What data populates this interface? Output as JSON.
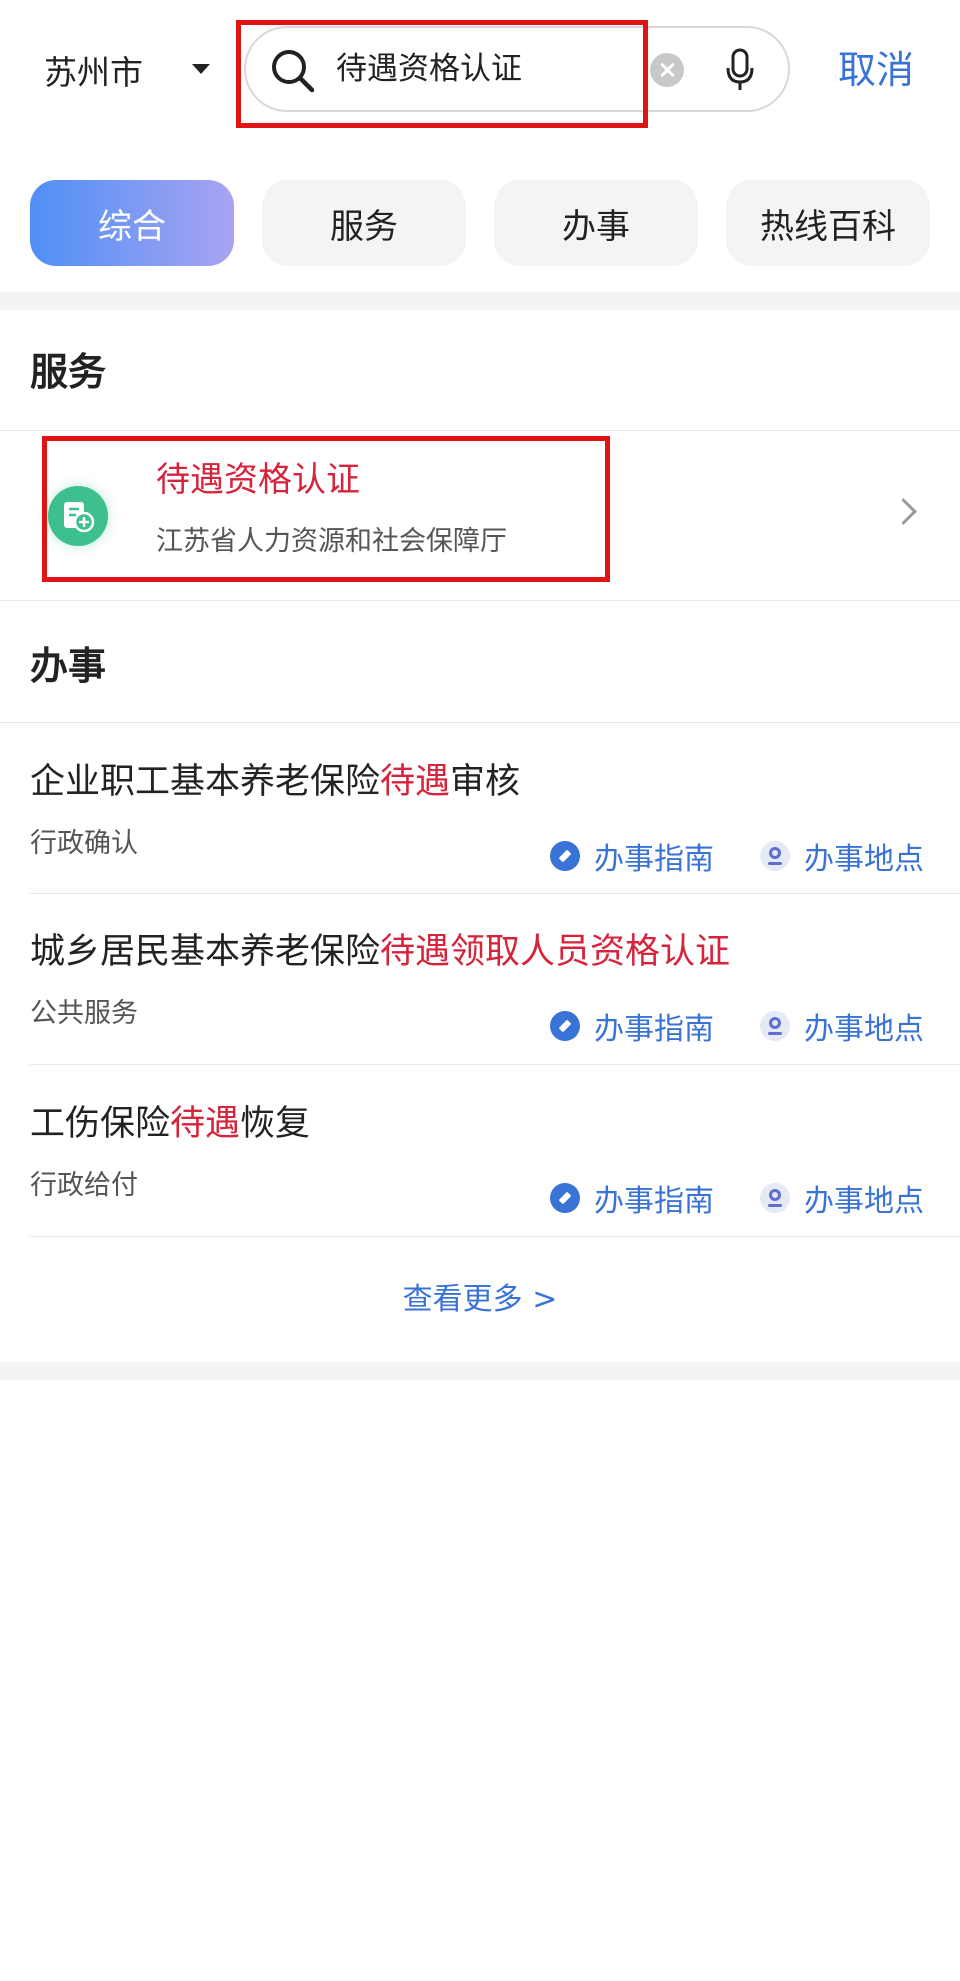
{
  "header": {
    "city": "苏州市",
    "search_value": "待遇资格认证",
    "cancel_label": "取消"
  },
  "tabs": [
    {
      "label": "综合",
      "active": true
    },
    {
      "label": "服务",
      "active": false
    },
    {
      "label": "办事",
      "active": false
    },
    {
      "label": "热线百科",
      "active": false
    }
  ],
  "services": {
    "title": "服务",
    "items": [
      {
        "name": "待遇资格认证",
        "org": "江苏省人力资源和社会保障厅",
        "icon": "document-plus-icon"
      }
    ]
  },
  "affairs": {
    "title": "办事",
    "items": [
      {
        "pre": "企业职工基本养老保险",
        "hl": "待遇",
        "post": "审核",
        "type": "行政确认"
      },
      {
        "pre": "城乡居民基本养老保险",
        "hl": "待遇领取人员资格认证",
        "post": "",
        "type": "公共服务"
      },
      {
        "pre": "工伤保险",
        "hl": "待遇",
        "post": "恢复",
        "type": "行政给付"
      }
    ],
    "guide_label": "办事指南",
    "location_label": "办事地点",
    "more_label": "查看更多 >"
  },
  "colors": {
    "accent": "#3a73d6",
    "highlight": "#d6243c",
    "service_icon": "#3dbf8e",
    "annotation": "#e01414"
  }
}
